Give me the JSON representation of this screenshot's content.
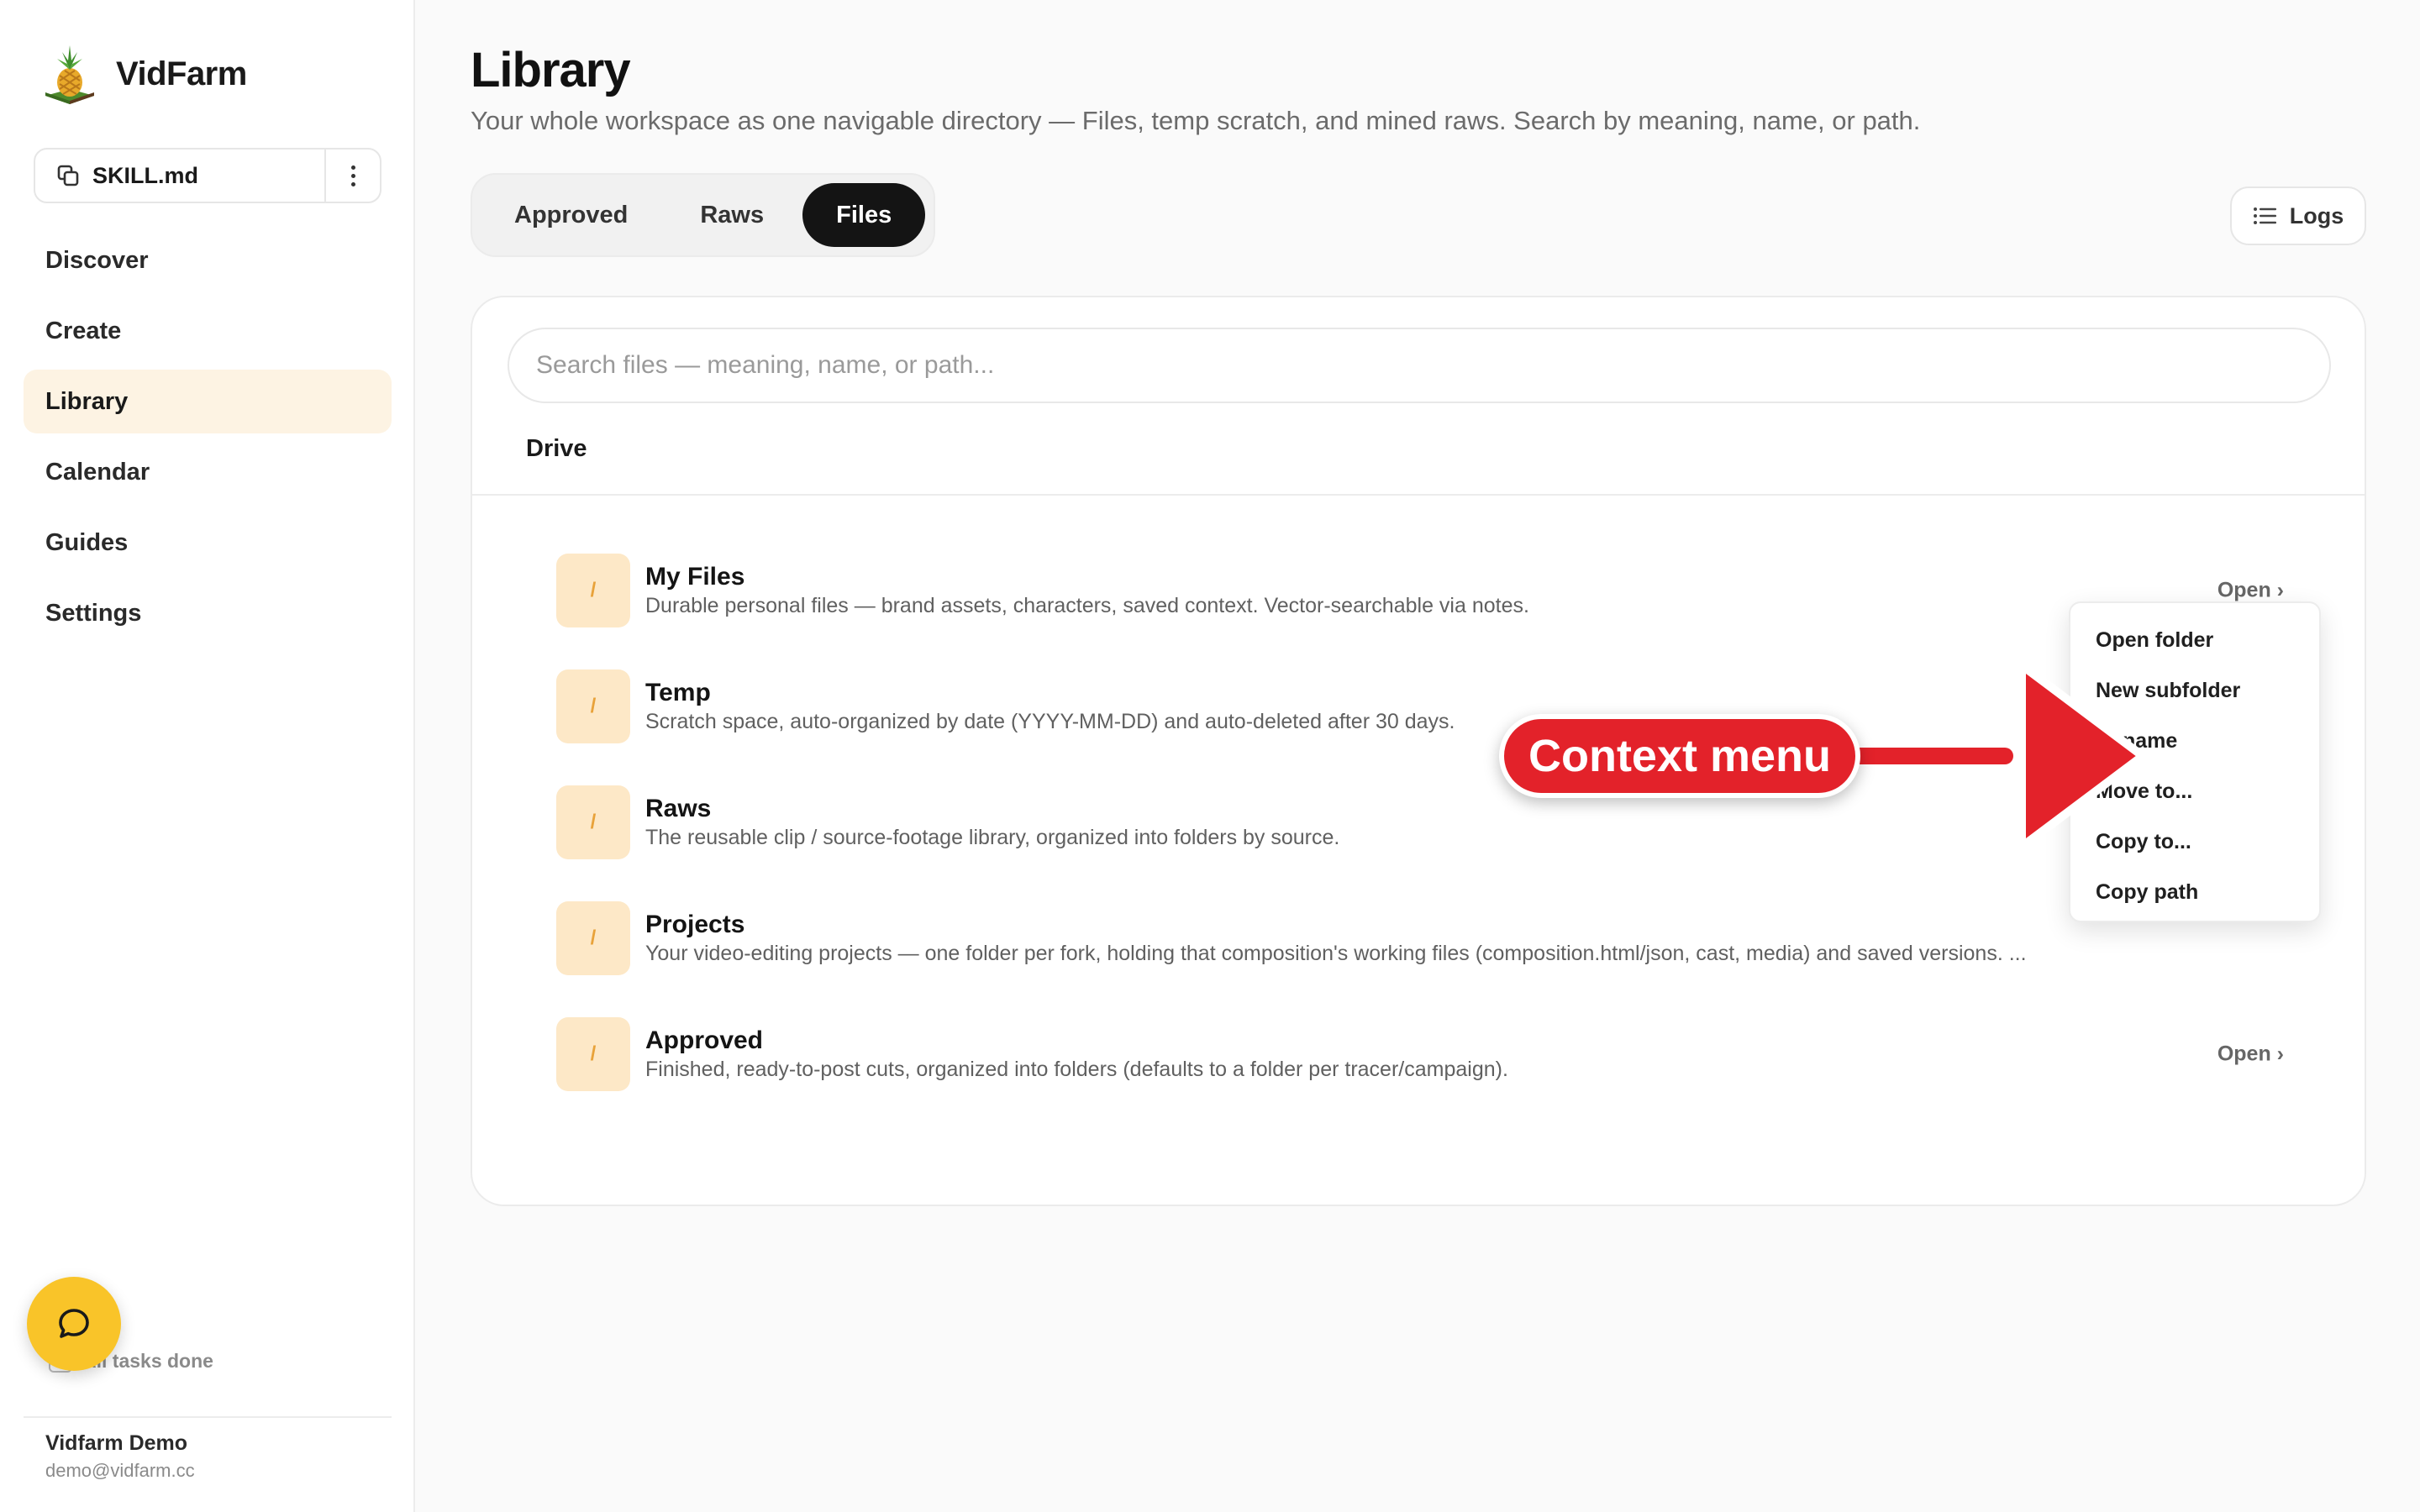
{
  "app": {
    "name": "VidFarm"
  },
  "sidebar": {
    "skill_button": {
      "label": "SKILL.md"
    },
    "nav": [
      {
        "label": "Discover",
        "active": false
      },
      {
        "label": "Create",
        "active": false
      },
      {
        "label": "Library",
        "active": true
      },
      {
        "label": "Calendar",
        "active": false
      },
      {
        "label": "Guides",
        "active": false
      },
      {
        "label": "Settings",
        "active": false
      }
    ],
    "tasks_status": "All tasks done",
    "user": {
      "name": "Vidfarm Demo",
      "email": "demo@vidfarm.cc"
    }
  },
  "main": {
    "title": "Library",
    "subtitle": "Your whole workspace as one navigable directory — Files, temp scratch, and mined raws. Search by meaning, name, or path.",
    "tabs": [
      {
        "label": "Approved",
        "active": false
      },
      {
        "label": "Raws",
        "active": false
      },
      {
        "label": "Files",
        "active": true
      }
    ],
    "logs_label": "Logs",
    "search": {
      "placeholder": "Search files — meaning, name, or path...",
      "value": ""
    },
    "section_label": "Drive",
    "folder_icon_glyph": "/",
    "open_label": "Open ›",
    "folders": [
      {
        "name": "My Files",
        "description": "Durable personal files — brand assets, characters, saved context. Vector-searchable via notes."
      },
      {
        "name": "Temp",
        "description": "Scratch space, auto-organized by date (YYYY-MM-DD) and auto-deleted after 30 days."
      },
      {
        "name": "Raws",
        "description": "The reusable clip / source-footage library, organized into folders by source."
      },
      {
        "name": "Projects",
        "description": "Your video-editing projects — one folder per fork, holding that composition's working files (composition.html/json, cast, media) and saved versions. ..."
      },
      {
        "name": "Approved",
        "description": "Finished, ready-to-post cuts, organized into folders (defaults to a folder per tracer/campaign)."
      }
    ]
  },
  "context_menu": {
    "items": [
      "Open folder",
      "New subfolder",
      "Rename",
      "Move to...",
      "Copy to...",
      "Copy path"
    ]
  },
  "annotation": {
    "label": "Context menu",
    "color": "#e3222a"
  },
  "colors": {
    "accent_bg": "#fdf3e3",
    "folder_bg": "#fde8c7",
    "fab": "#f9c429",
    "tab_active": "#141414"
  }
}
